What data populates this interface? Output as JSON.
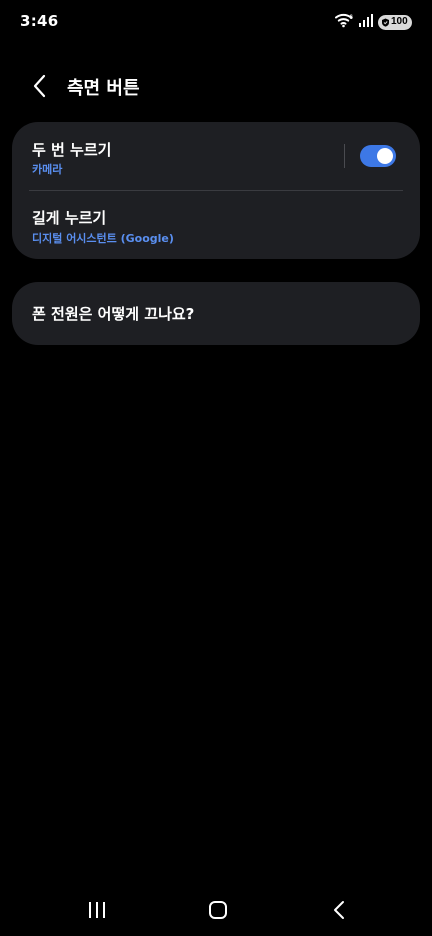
{
  "status_bar": {
    "time": "3:46",
    "battery": "100",
    "icons": [
      "wifi-icon",
      "signal-icon",
      "battery-icon"
    ]
  },
  "header": {
    "title": "측면 버튼",
    "back_icon": "chevron-left-icon"
  },
  "settings": {
    "double_press": {
      "title": "두 번 누르기",
      "subtitle": "카메라",
      "toggle_on": true
    },
    "long_press": {
      "title": "길게 누르기",
      "subtitle": "디지털 어시스턴트 (Google)"
    }
  },
  "faq": {
    "title": "폰 전원은 어떻게 끄나요?"
  },
  "nav_bar": {
    "icons": [
      "recents-icon",
      "home-icon",
      "back-icon"
    ]
  },
  "colors": {
    "background": "#000000",
    "card": "#1e1f23",
    "accent": "#3d78e6",
    "subtitle": "#5a8ff0"
  }
}
